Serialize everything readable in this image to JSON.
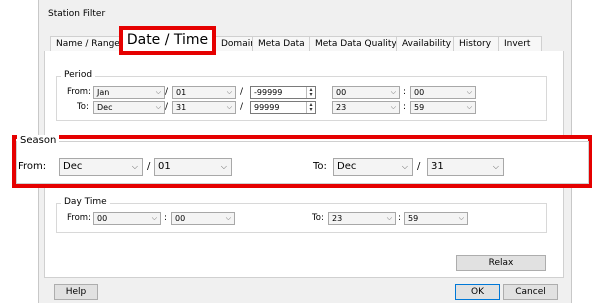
{
  "dialog": {
    "title": "Station Filter"
  },
  "tabs": [
    {
      "label": "Name / Range"
    },
    {
      "label": "Date / Time"
    },
    {
      "label": "Domain"
    },
    {
      "label": "Meta Data"
    },
    {
      "label": "Meta Data Quality"
    },
    {
      "label": "Availability"
    },
    {
      "label": "History"
    },
    {
      "label": "Invert"
    }
  ],
  "period": {
    "title": "Period",
    "from_label": "From:",
    "to_label": "To:",
    "from": {
      "month": "Jan",
      "day": "01",
      "year": "-99999",
      "hour": "00",
      "minute": "00"
    },
    "to": {
      "month": "Dec",
      "day": "31",
      "year": "99999",
      "hour": "23",
      "minute": "59"
    }
  },
  "season": {
    "title": "Season",
    "from_label": "From:",
    "to_label": "To:",
    "from": {
      "month": "Dec",
      "day": "01"
    },
    "to": {
      "month": "Dec",
      "day": "31"
    }
  },
  "day_time": {
    "title": "Day Time",
    "from_label": "From:",
    "to_label": "To:",
    "from": {
      "hour": "00",
      "minute": "00"
    },
    "to": {
      "hour": "23",
      "minute": "59"
    }
  },
  "separators": {
    "slash": "/",
    "colon": ":"
  },
  "buttons": {
    "relax": "Relax",
    "help": "Help",
    "ok": "OK",
    "cancel": "Cancel"
  },
  "highlight_color": "#e50000"
}
